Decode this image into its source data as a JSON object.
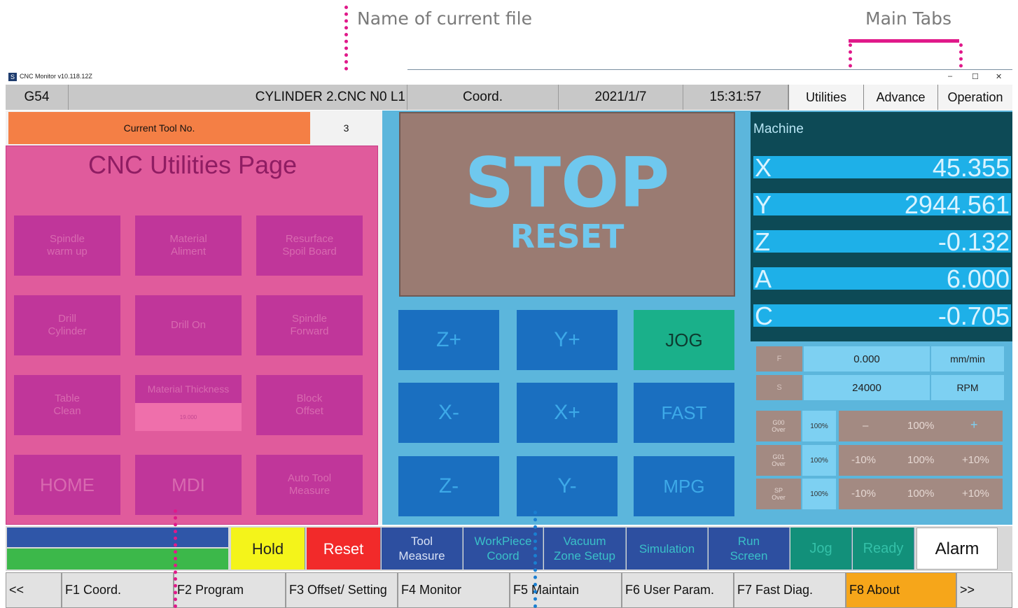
{
  "annotations": {
    "current_file": "Name of current file",
    "main_tabs": "Main Tabs"
  },
  "window": {
    "title": "CNC Monitor v10.118.12Z",
    "minimize": "–",
    "maximize": "☐",
    "close": "✕"
  },
  "header": {
    "coord_system": "G54",
    "file": "CYLINDER 2.CNC N0 L1",
    "view": "Coord.",
    "date": "2021/1/7",
    "time": "15:31:57",
    "tabs": [
      "Utilities",
      "Advance",
      "Operation"
    ]
  },
  "tool": {
    "label": "Current Tool No.",
    "number": "3"
  },
  "utilities": {
    "title": "CNC Utilities Page",
    "buttons": [
      {
        "line1": "Spindle",
        "line2": "warm up"
      },
      {
        "line1": "Material",
        "line2": "Aliment"
      },
      {
        "line1": "Resurface",
        "line2": "Spoil Board"
      },
      {
        "line1": "Drill",
        "line2": "Cylinder"
      },
      {
        "line1": "Drill On",
        "line2": ""
      },
      {
        "line1": "Spindle",
        "line2": "Forward"
      },
      {
        "line1": "Table",
        "line2": "Clean"
      },
      {
        "line1": "Block",
        "line2": "Offset"
      },
      {
        "line1": "HOME",
        "line2": ""
      },
      {
        "line1": "MDI",
        "line2": ""
      },
      {
        "line1": "Auto Tool",
        "line2": "Measure"
      }
    ],
    "material_thickness_label": "Material Thickness",
    "material_thickness_value": "19.000"
  },
  "stop_panel": {
    "stop": "STOP",
    "reset": "RESET"
  },
  "jog": {
    "buttons": [
      "Z+",
      "Y+",
      "JOG",
      "X-",
      "X+",
      "FAST",
      "Z-",
      "Y-",
      "MPG"
    ]
  },
  "machine": {
    "label": "Machine",
    "axes": [
      {
        "name": "X",
        "value": "45.355"
      },
      {
        "name": "Y",
        "value": "2944.561"
      },
      {
        "name": "Z",
        "value": "-0.132"
      },
      {
        "name": "A",
        "value": "6.000"
      },
      {
        "name": "C",
        "value": "-0.705"
      }
    ]
  },
  "feed_spindle": {
    "f_label": "F",
    "f_value": "0.000",
    "f_unit": "mm/min",
    "s_label": "S",
    "s_value": "24000",
    "s_unit": "RPM"
  },
  "overrides": [
    {
      "key_line1": "G00",
      "key_line2": "Over",
      "pct": "100%",
      "minus": "–",
      "mid": "100%",
      "plus": "+"
    },
    {
      "key_line1": "G01",
      "key_line2": "Over",
      "pct": "100%",
      "minus": "-10%",
      "mid": "100%",
      "plus": "+10%"
    },
    {
      "key_line1": "SP",
      "key_line2": "Over",
      "pct": "100%",
      "minus": "-10%",
      "mid": "100%",
      "plus": "+10%"
    }
  ],
  "status_bar": {
    "hold": "Hold",
    "reset": "Reset",
    "tool_measure": [
      "Tool",
      "Measure"
    ],
    "workpiece_coord": [
      "WorkPiece",
      "Coord"
    ],
    "vacuum": [
      "Vacuum",
      "Zone Setup"
    ],
    "simulation": "Simulation",
    "run_screen": [
      "Run",
      "Screen"
    ],
    "jog": "Jog",
    "ready": "Ready",
    "alarm": "Alarm"
  },
  "fkeys": [
    "<<",
    "F1 Coord.",
    "F2 Program",
    "F3 Offset/ Setting",
    "F4 Monitor",
    "F5 Maintain",
    "F6 User Param.",
    "F7 Fast Diag.",
    "F8 About",
    ">>"
  ],
  "colors": {
    "accent_orange": "#f47f45",
    "util_panel_pink": "#e05b9c",
    "util_button": "#c0369a",
    "stop_panel": "#9a7b72",
    "jog_button": "#1a6fc0",
    "jog_active": "#1ab08a",
    "machine_panel": "#0d4a56",
    "axis_row": "#1eb0e8",
    "hold_yellow": "#f4f41a",
    "reset_red": "#f22a2a",
    "f8_orange": "#f6a61a",
    "annotation_magenta": "#e0198a"
  }
}
